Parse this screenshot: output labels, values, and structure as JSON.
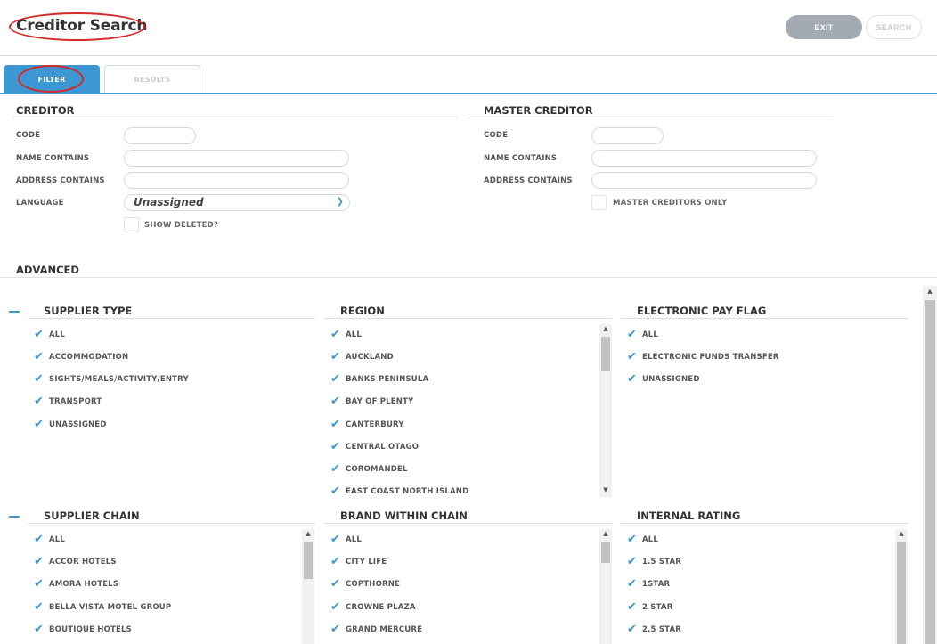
{
  "header": {
    "title": "Creditor Search",
    "exit_label": "EXIT",
    "search_label": "SEARCH"
  },
  "tabs": [
    {
      "label": "FILTER"
    },
    {
      "label": "RESULTS"
    }
  ],
  "creditor": {
    "title": "CREDITOR",
    "code_label": "CODE",
    "name_label": "NAME CONTAINS",
    "address_label": "ADDRESS CONTAINS",
    "language_label": "LANGUAGE",
    "language_value": "Unassigned",
    "show_deleted_label": "SHOW DELETED?"
  },
  "master": {
    "title": "MASTER CREDITOR",
    "code_label": "CODE",
    "name_label": "NAME CONTAINS",
    "address_label": "ADDRESS CONTAINS",
    "only_label": "MASTER CREDITORS ONLY"
  },
  "advanced": {
    "title": "ADVANCED"
  },
  "groups": {
    "supplier_type": {
      "title": "SUPPLIER TYPE",
      "items": [
        "ALL",
        "ACCOMMODATION",
        "SIGHTS/MEALS/ACTIVITY/ENTRY",
        "TRANSPORT",
        "UNASSIGNED"
      ]
    },
    "region": {
      "title": "REGION",
      "items": [
        "ALL",
        "AUCKLAND",
        "BANKS PENINSULA",
        "BAY OF PLENTY",
        "CANTERBURY",
        "CENTRAL OTAGO",
        "COROMANDEL",
        "EAST COAST NORTH ISLAND"
      ]
    },
    "electronic_pay": {
      "title": "ELECTRONIC PAY FLAG",
      "items": [
        "ALL",
        "ELECTRONIC FUNDS TRANSFER",
        "UNASSIGNED"
      ]
    },
    "supplier_chain": {
      "title": "SUPPLIER CHAIN",
      "items": [
        "ALL",
        "ACCOR HOTELS",
        "AMORA HOTELS",
        "BELLA VISTA MOTEL GROUP",
        "BOUTIQUE HOTELS"
      ]
    },
    "brand": {
      "title": "BRAND WITHIN CHAIN",
      "items": [
        "ALL",
        "CITY LIFE",
        "COPTHORNE",
        "CROWNE PLAZA",
        "GRAND MERCURE"
      ]
    },
    "rating": {
      "title": "INTERNAL RATING",
      "items": [
        "ALL",
        "1.5 STAR",
        "1STAR",
        "2 STAR",
        "2.5 STAR"
      ]
    }
  },
  "colors": {
    "accent": "#3d97d3",
    "annotation": "#d42a2a",
    "exit_bg": "#a3aab2"
  }
}
